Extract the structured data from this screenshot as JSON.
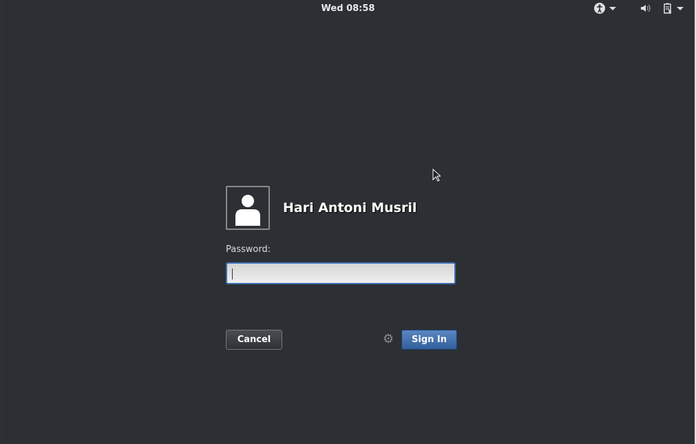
{
  "topbar": {
    "clock": "Wed 08:58"
  },
  "tray_icons": [
    "accessibility-icon",
    "volume-icon",
    "battery-icon"
  ],
  "login": {
    "username": "Hari Antoni Musril",
    "password_label": "Password:",
    "password_value": "",
    "cancel_label": "Cancel",
    "signin_label": "Sign In"
  },
  "colors": {
    "accent": "#3b6fb3",
    "background": "#2c3034"
  }
}
